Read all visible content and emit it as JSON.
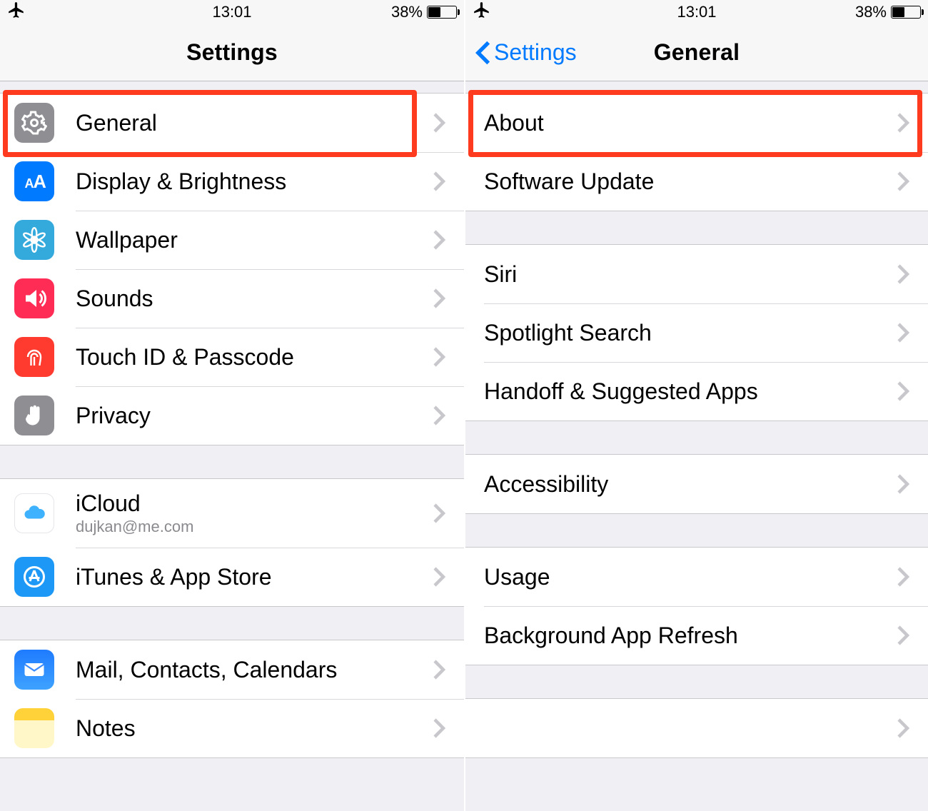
{
  "status": {
    "time": "13:01",
    "battery_pct": "38%"
  },
  "left": {
    "title": "Settings",
    "groups": [
      {
        "rows": [
          {
            "id": "general",
            "label": "General",
            "icon": "gear"
          },
          {
            "id": "display",
            "label": "Display & Brightness",
            "icon": "aa"
          },
          {
            "id": "wallpaper",
            "label": "Wallpaper",
            "icon": "flower"
          },
          {
            "id": "sounds",
            "label": "Sounds",
            "icon": "speaker"
          },
          {
            "id": "touchid",
            "label": "Touch ID & Passcode",
            "icon": "fingerprint"
          },
          {
            "id": "privacy",
            "label": "Privacy",
            "icon": "hand"
          }
        ]
      },
      {
        "rows": [
          {
            "id": "icloud",
            "label": "iCloud",
            "sub": "dujkan@me.com",
            "icon": "cloud"
          },
          {
            "id": "appstore",
            "label": "iTunes & App Store",
            "icon": "appstore"
          }
        ]
      },
      {
        "rows": [
          {
            "id": "mail",
            "label": "Mail, Contacts, Calendars",
            "icon": "mail"
          },
          {
            "id": "notes",
            "label": "Notes",
            "icon": "notes"
          }
        ]
      }
    ]
  },
  "right": {
    "back": "Settings",
    "title": "General",
    "groups": [
      {
        "rows": [
          {
            "id": "about",
            "label": "About"
          },
          {
            "id": "swupd",
            "label": "Software Update"
          }
        ]
      },
      {
        "rows": [
          {
            "id": "siri",
            "label": "Siri"
          },
          {
            "id": "spotlight",
            "label": "Spotlight Search"
          },
          {
            "id": "handoff",
            "label": "Handoff & Suggested Apps"
          }
        ]
      },
      {
        "rows": [
          {
            "id": "accessibility",
            "label": "Accessibility"
          }
        ]
      },
      {
        "rows": [
          {
            "id": "usage",
            "label": "Usage"
          },
          {
            "id": "bgrefresh",
            "label": "Background App Refresh"
          }
        ]
      },
      {
        "rows": [
          {
            "id": "autolock",
            "label": ""
          }
        ]
      }
    ]
  }
}
